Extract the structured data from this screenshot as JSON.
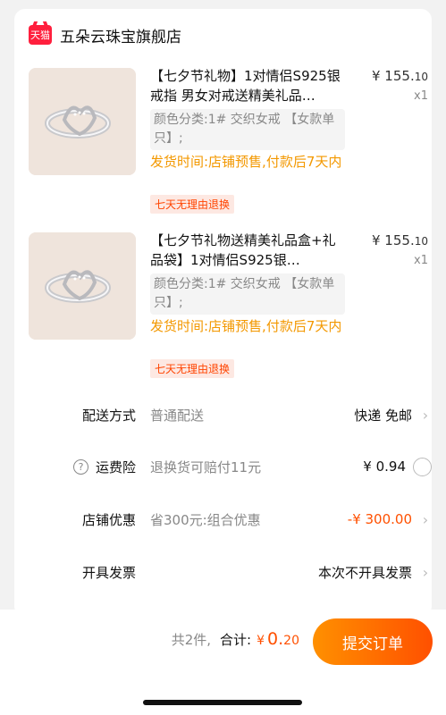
{
  "shop": {
    "badge": "天猫",
    "name": "五朵云珠宝旗舰店"
  },
  "products": [
    {
      "title": "【七夕节礼物】1对情侣S925银戒指 男女对戒送精美礼品…",
      "price_int": "¥ 155.",
      "price_dec": "10",
      "qty": "x1",
      "sku": "颜色分类:1# 交织女戒 【女款单只】;",
      "ship": "发货时间:店铺预售,付款后7天内",
      "refund": "七天无理由退换"
    },
    {
      "title": "【七夕节礼物送精美礼品盒+礼品袋】1对情侣S925银…",
      "price_int": "¥ 155.",
      "price_dec": "10",
      "qty": "x1",
      "sku": "颜色分类:1# 交织女戒 【女款单只】;",
      "ship": "发货时间:店铺预售,付款后7天内",
      "refund": "七天无理由退换"
    }
  ],
  "delivery": {
    "label": "配送方式",
    "method": "普通配送",
    "value": "快递 免邮"
  },
  "insurance": {
    "label": "运费险",
    "desc": "退换货可赔付11元",
    "value": "¥ 0.94"
  },
  "discount": {
    "label": "店铺优惠",
    "desc": "省300元:组合优惠",
    "value": "-¥ 300.00"
  },
  "invoice": {
    "label": "开具发票",
    "value": "本次不开具发票"
  },
  "footer": {
    "count": "共2件,",
    "total_label": "合计:",
    "currency": "¥",
    "amount_int": "0.",
    "amount_dec": "20",
    "submit": "提交订单"
  },
  "colors": {
    "accent": "#ff5000",
    "ship_orange": "#f39800",
    "tmall_red": "#ff1f3d"
  }
}
